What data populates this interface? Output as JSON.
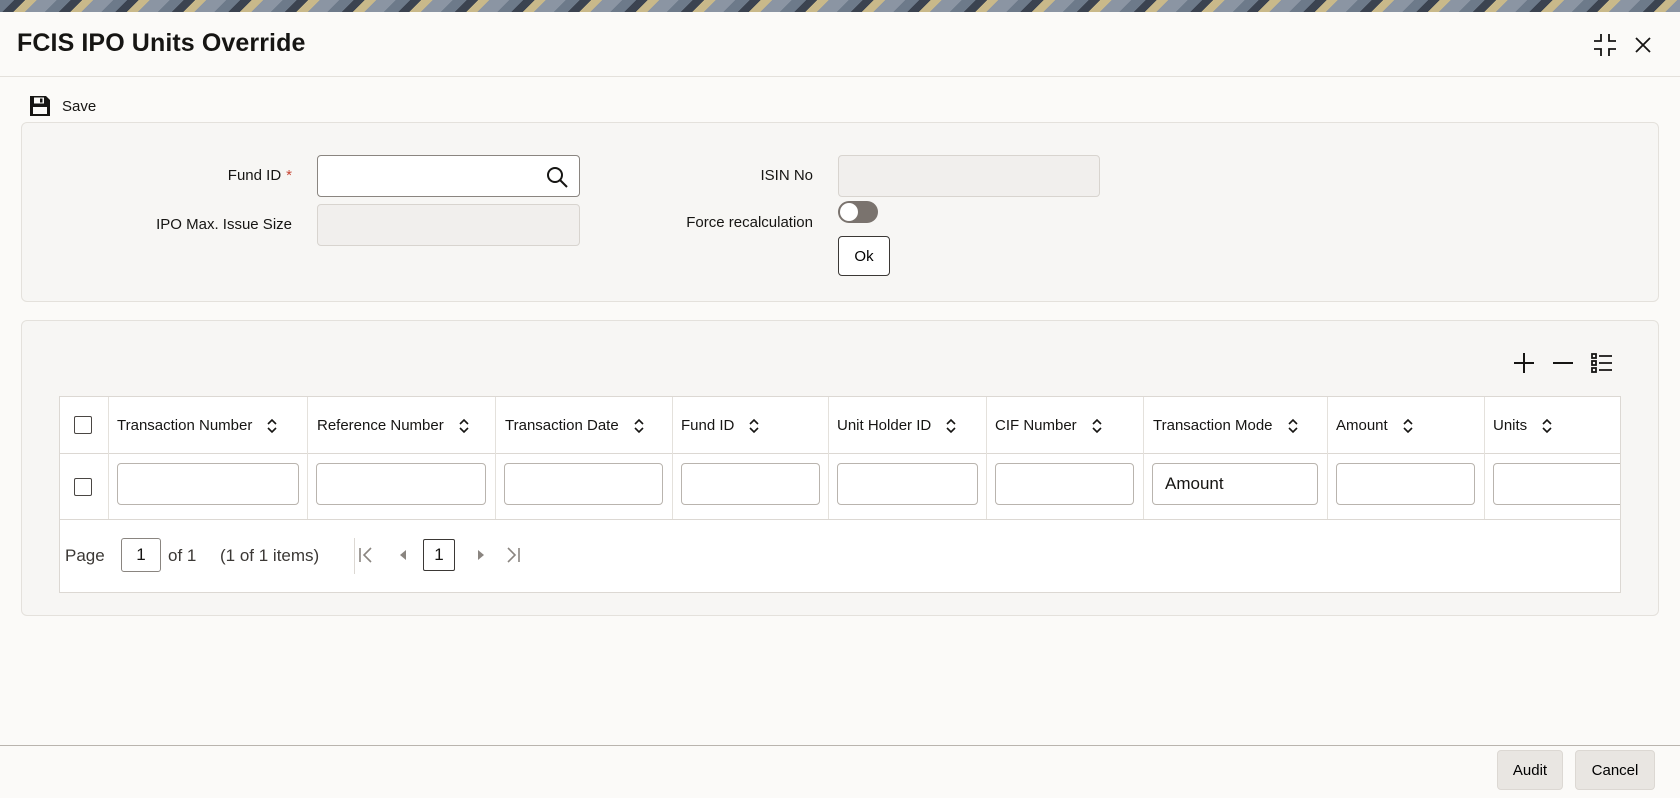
{
  "window": {
    "title": "FCIS IPO Units Override"
  },
  "toolbar": {
    "save_label": "Save"
  },
  "form": {
    "fund_id_label": "Fund ID",
    "required_marker": "*",
    "fund_id_value": "",
    "ipo_max_issue_size_label": "IPO Max. Issue Size",
    "ipo_max_issue_size_value": "",
    "isin_no_label": "ISIN No",
    "isin_no_value": "",
    "force_recalculation_label": "Force recalculation",
    "force_recalculation_on": false,
    "ok_label": "Ok"
  },
  "grid": {
    "columns": [
      "Transaction Number",
      "Reference Number",
      "Transaction Date",
      "Fund ID",
      "Unit Holder ID",
      "CIF Number",
      "Transaction Mode",
      "Amount",
      "Units"
    ],
    "rows": [
      {
        "transaction_number": "",
        "reference_number": "",
        "transaction_date": "",
        "fund_id": "",
        "unit_holder_id": "",
        "cif_number": "",
        "transaction_mode": "Amount",
        "amount": "",
        "units": ""
      }
    ],
    "pagination": {
      "page_label": "Page",
      "page_value": "1",
      "of_label": "of 1",
      "items_label": "(1 of 1 items)",
      "current_page": "1"
    }
  },
  "footer": {
    "audit_label": "Audit",
    "cancel_label": "Cancel"
  },
  "colors": {
    "accent_toggle": "#7a736e",
    "required": "#c74634",
    "background": "#fbfaf8"
  }
}
